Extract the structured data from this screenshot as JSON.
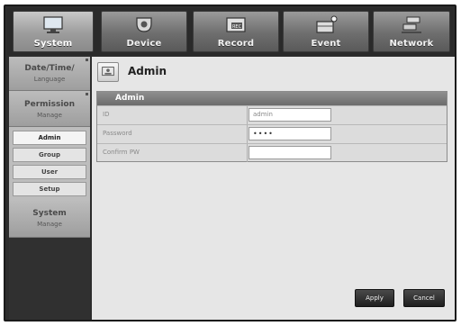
{
  "tabs": [
    {
      "label": "System",
      "icon": "monitor-icon",
      "active": true
    },
    {
      "label": "Device",
      "icon": "camera-icon",
      "active": false
    },
    {
      "label": "Record",
      "icon": "record-icon",
      "active": false
    },
    {
      "label": "Event",
      "icon": "event-icon",
      "active": false
    },
    {
      "label": "Network",
      "icon": "network-icon",
      "active": false
    }
  ],
  "sidebar": {
    "groups": [
      {
        "title": "Date/Time/",
        "subtitle": "Language"
      },
      {
        "title": "Permission",
        "subtitle": "Manage"
      },
      {
        "title": "System",
        "subtitle": "Manage"
      }
    ],
    "items": [
      {
        "label": "Admin",
        "active": true
      },
      {
        "label": "Group",
        "active": false
      },
      {
        "label": "User",
        "active": false
      },
      {
        "label": "Setup",
        "active": false
      }
    ]
  },
  "page": {
    "title": "Admin",
    "section_title": "Admin",
    "fields": [
      {
        "label": "ID",
        "value": "admin"
      },
      {
        "label": "Password",
        "value": "••••"
      },
      {
        "label": "Confirm PW",
        "value": ""
      }
    ]
  },
  "buttons": {
    "apply": "Apply",
    "cancel": "Cancel"
  }
}
